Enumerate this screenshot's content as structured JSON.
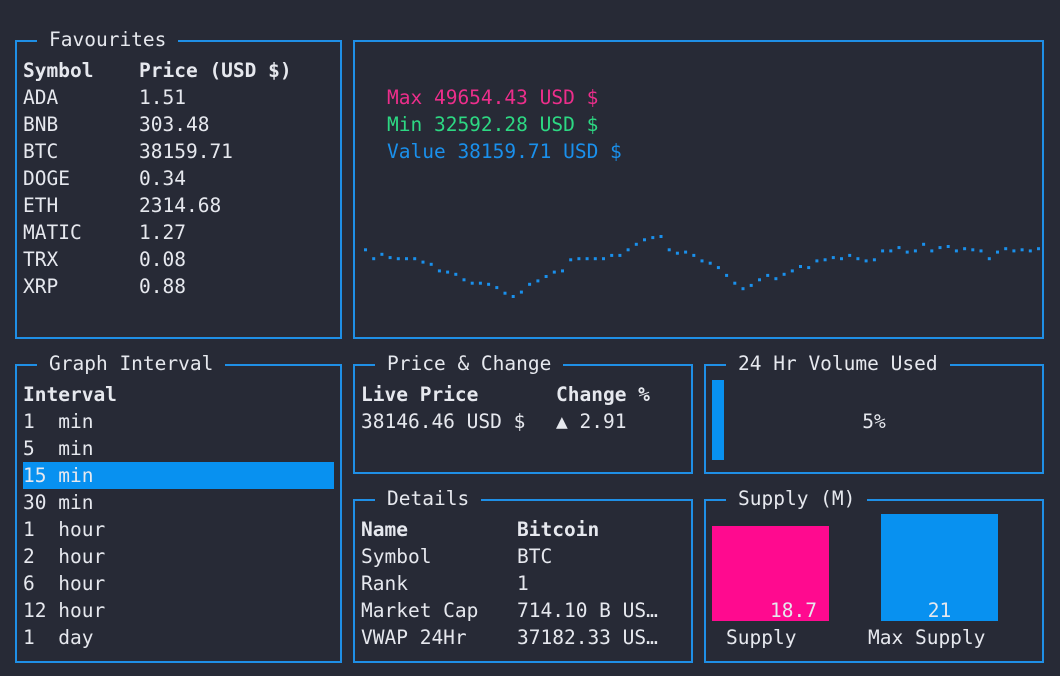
{
  "favourites": {
    "title": "Favourites",
    "header_symbol": "Symbol",
    "header_price": "Price (USD $)",
    "rows": [
      {
        "symbol": "ADA",
        "price": "1.51"
      },
      {
        "symbol": "BNB",
        "price": "303.48"
      },
      {
        "symbol": "BTC",
        "price": "38159.71"
      },
      {
        "symbol": "DOGE",
        "price": "0.34"
      },
      {
        "symbol": "ETH",
        "price": "2314.68"
      },
      {
        "symbol": "MATIC",
        "price": "1.27"
      },
      {
        "symbol": "TRX",
        "price": "0.08"
      },
      {
        "symbol": "XRP",
        "price": "0.88"
      }
    ]
  },
  "graph": {
    "max_text": "Max 49654.43 USD $",
    "min_text": "Min 32592.28 USD $",
    "value_text": "Value 38159.71 USD $",
    "colors": {
      "max": "#ec2e8b",
      "min": "#2dd883",
      "value": "#1a90ec"
    }
  },
  "graph_interval": {
    "title": "Graph Interval",
    "header": "Interval",
    "items": [
      "1  min",
      "5  min",
      "15 min",
      "30 min",
      "1  hour",
      "2  hour",
      "6  hour",
      "12 hour",
      "1  day"
    ],
    "selected_index": 2
  },
  "price_change": {
    "title": "Price & Change",
    "header_live": "Live Price",
    "header_change": "Change %",
    "live_value": "38146.46 USD $",
    "change_value": "▲ 2.91"
  },
  "volume": {
    "title": "24 Hr Volume Used",
    "percent_text": "5%",
    "percent": 5
  },
  "details": {
    "title": "Details",
    "rows": [
      {
        "label": "Name",
        "value": "Bitcoin"
      },
      {
        "label": "Symbol",
        "value": "BTC"
      },
      {
        "label": "Rank",
        "value": "1"
      },
      {
        "label": "Market Cap",
        "value": "714.10 B US…"
      },
      {
        "label": "VWAP 24Hr",
        "value": "37182.33 US…"
      }
    ]
  },
  "supply": {
    "title": "Supply (M)",
    "bars": [
      {
        "label": "Supply",
        "value": "18.7",
        "amount": 18.7,
        "color": "#ff0a8f"
      },
      {
        "label": "Max Supply",
        "value": "21",
        "amount": 21,
        "color": "#0891f0"
      }
    ]
  },
  "chart_data": {
    "type": "line",
    "series": [
      {
        "values": [
          38.9,
          38.1,
          38.5,
          38.2,
          38.1,
          38.1,
          38.1,
          37.8,
          37.6,
          37.0,
          36.9,
          36.7,
          36.2,
          35.9,
          35.9,
          35.8,
          35.5,
          35.0,
          34.7,
          35.1,
          35.8,
          36.1,
          36.5,
          36.9,
          37.0,
          38.0,
          38.1,
          38.1,
          38.1,
          38.1,
          38.4,
          38.4,
          38.9,
          39.4,
          39.8,
          40.0,
          40.1,
          38.9,
          38.6,
          38.7,
          38.4,
          37.9,
          37.7,
          37.3,
          36.6,
          35.9,
          35.4,
          35.7,
          36.2,
          36.6,
          36.3,
          36.7,
          37.0,
          37.4,
          37.3,
          37.9,
          38.0,
          38.2,
          38.1,
          38.4,
          38.1,
          37.9,
          38.0,
          38.8,
          38.8,
          39.1,
          38.7,
          38.8,
          39.4,
          38.8,
          39.1,
          39.2,
          38.8,
          39.0,
          38.9,
          38.8,
          38.1,
          38.7,
          39.0,
          38.8,
          38.9,
          38.8,
          39.0
        ]
      }
    ]
  }
}
